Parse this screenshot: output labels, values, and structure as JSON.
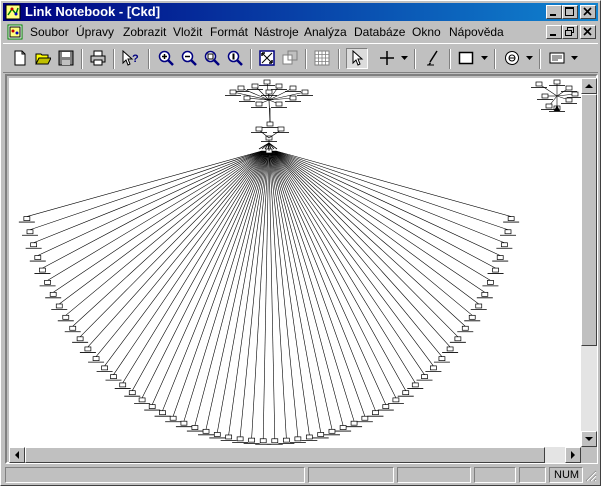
{
  "window": {
    "title": "Link Notebook - [Ckd]"
  },
  "menu": {
    "items": [
      {
        "label": "Soubor",
        "accel": "S"
      },
      {
        "label": "Úpravy",
        "accel": "Ú"
      },
      {
        "label": "Zobrazit",
        "accel": "Z"
      },
      {
        "label": "Vložit",
        "accel": "V"
      },
      {
        "label": "Formát",
        "accel": "F"
      },
      {
        "label": "Nástroje",
        "accel": "N"
      },
      {
        "label": "Analýza",
        "accel": "A"
      },
      {
        "label": "Databáze",
        "accel": "D"
      },
      {
        "label": "Okno",
        "accel": "O"
      },
      {
        "label": "Nápověda",
        "accel": "N"
      }
    ]
  },
  "toolbar": {
    "icons": [
      "new-icon",
      "open-icon",
      "save-icon",
      "print-icon",
      "help-pointer-icon",
      "zoom-in-icon",
      "zoom-out-icon",
      "zoom-window-icon",
      "zoom-fit-icon",
      "fit-page-icon",
      "fit-selection-icon",
      "grid-icon",
      "select-arrow-icon",
      "crosshair-icon",
      "link-pen-icon",
      "rectangle-icon",
      "circle-icon",
      "card-icon"
    ]
  },
  "statusbar": {
    "num": "NUM"
  },
  "colors": {
    "title_start": "#000080",
    "title_end": "#1084d0",
    "chrome": "#c0c0c0",
    "canvas": "#ffffff"
  }
}
